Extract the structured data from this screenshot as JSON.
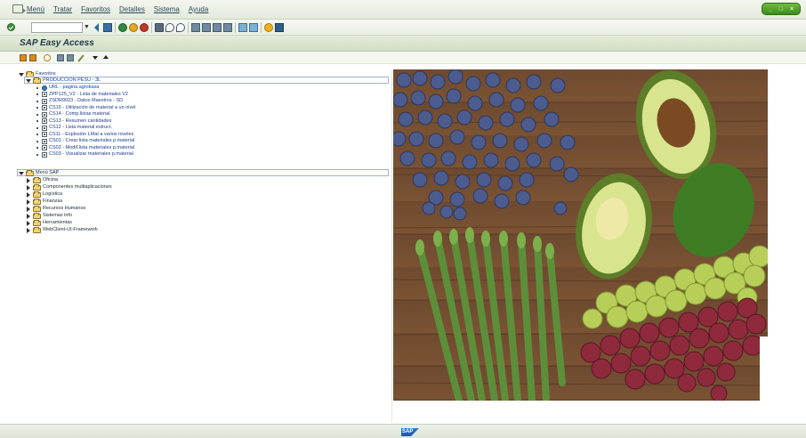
{
  "menu": {
    "items": [
      "Menú",
      "Tratar",
      "Favoritos",
      "Detalles",
      "Sistema",
      "Ayuda"
    ]
  },
  "toolbar": {
    "command_field_value": "",
    "icons": [
      "ok-icon",
      "back-icon",
      "save-icon",
      "back-green-icon",
      "exit-icon",
      "cancel-icon",
      "print-icon",
      "find-icon",
      "find-next-icon",
      "first-page-icon",
      "prev-page-icon",
      "next-page-icon",
      "last-page-icon",
      "new-session-icon",
      "shortcut-icon",
      "help-icon",
      "customize-layout-icon"
    ]
  },
  "header": {
    "title": "SAP Easy Access"
  },
  "tree": {
    "favorites_label": "Favoritos",
    "favorites_folder": "PRODUCCION PESU - 3L",
    "favorites_items": [
      {
        "type": "url",
        "label": "URL - pagina agrokasa"
      },
      {
        "type": "tx",
        "label": "ZPP125_V2 - Lista de materiales V2"
      },
      {
        "type": "tx",
        "label": "ZSDR0023 - Datos Maestros - SD"
      },
      {
        "type": "tx",
        "label": "CS15 - Utilización de material a un nivel"
      },
      {
        "type": "tx",
        "label": "CS14 - Comp.listas material"
      },
      {
        "type": "tx",
        "label": "CS13 - Resumen cantidades"
      },
      {
        "type": "tx",
        "label": "CS12 - Lista material estruct."
      },
      {
        "type": "tx",
        "label": "CS11 - Explosión LMat a varios niveles"
      },
      {
        "type": "tx",
        "label": "CS01 - Crear lista materiales p.material"
      },
      {
        "type": "tx",
        "label": "CS02 - Modif.lista materiales p.material"
      },
      {
        "type": "tx",
        "label": "CS03 - Visualizar materiales p.material"
      }
    ],
    "sap_menu_label": "Menú SAP",
    "sap_menu_items": [
      "Oficina",
      "Componentes multiaplicaciones",
      "Logística",
      "Finanzas",
      "Recursos Humanos",
      "Sistemas info",
      "Herramientas",
      "WebClient-UI-Framework"
    ]
  },
  "status": {
    "logo_text": "SAP"
  },
  "colors": {
    "accent_green": "#4e9a2a",
    "title_band": "#d9e3ce",
    "tree_link": "#1e3c8f"
  }
}
